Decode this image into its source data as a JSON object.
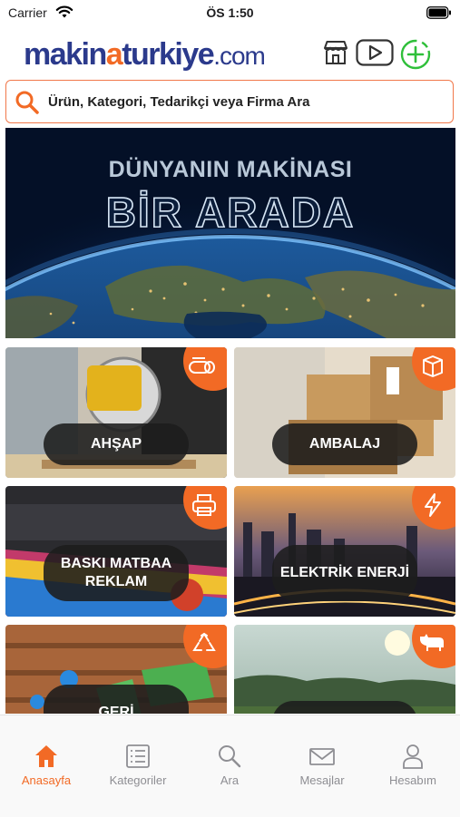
{
  "status_bar": {
    "carrier": "Carrier",
    "time": "ÖS 1:50"
  },
  "header": {
    "logo_part1": "makin",
    "logo_accent": "a",
    "logo_part2": "turkiye",
    "logo_suffix": ".com",
    "icons": [
      "store-icon",
      "video-play-icon",
      "add-circle-icon"
    ]
  },
  "search": {
    "placeholder": "Ürün, Kategori, Tedarikçi veya Firma Ara"
  },
  "banner": {
    "line1": "DÜNYANIN MAKİNASI",
    "line2": "BİR ARADA"
  },
  "categories": [
    {
      "label": "AHŞAP",
      "icon": "saw-log-icon"
    },
    {
      "label": "AMBALAJ",
      "icon": "package-icon"
    },
    {
      "label": "BASKI MATBAA REKLAM",
      "icon": "printer-icon"
    },
    {
      "label": "ELEKTRİK ENERJİ",
      "icon": "lightning-icon"
    },
    {
      "label": "GERİ",
      "icon": "recycle-icon"
    },
    {
      "label": "",
      "icon": "cow-icon"
    }
  ],
  "tabs": [
    {
      "label": "Anasayfa",
      "icon": "home-icon",
      "active": true
    },
    {
      "label": "Kategoriler",
      "icon": "list-icon"
    },
    {
      "label": "Ara",
      "icon": "search-icon"
    },
    {
      "label": "Mesajlar",
      "icon": "mail-icon"
    },
    {
      "label": "Hesabım",
      "icon": "user-icon"
    }
  ],
  "colors": {
    "brand_blue": "#2b3a8c",
    "accent_orange": "#f26a25",
    "tab_inactive": "#8e8e93"
  }
}
